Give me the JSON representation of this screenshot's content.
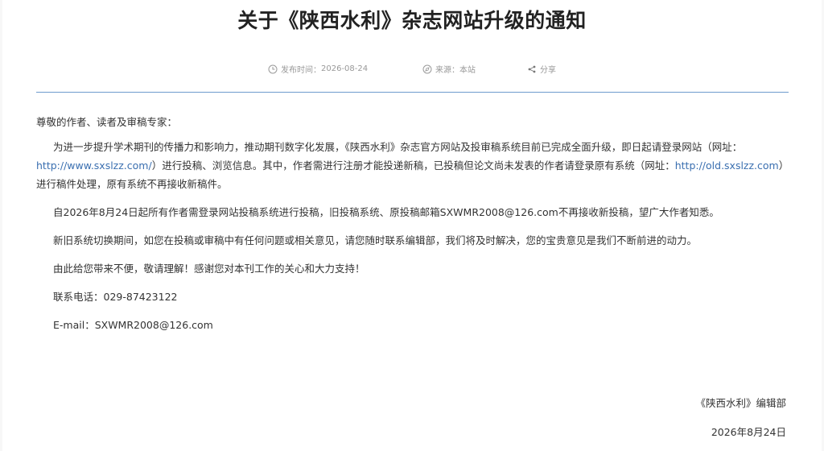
{
  "title": "关于《陕西水利》杂志网站升级的通知",
  "meta": {
    "publish_label": "发布时间：",
    "publish_date": "2026-08-24",
    "source_label": "来源：",
    "source_value": "本站",
    "share_label": "分享"
  },
  "body": {
    "salutation": "尊敬的作者、读者及审稿专家：",
    "p1_part1": "为进一步提升学术期刊的传播力和影响力，推动期刊数字化发展，《陕西水利》杂志官方网站及投审稿系统目前已完成全面升级，即日起请登录网站（网址：",
    "p1_link1": "http://www.sxslzz.com/",
    "p1_part2": "）进行投稿、浏览信息。其中，作者需进行注册才能投递新稿，已投稿但论文尚未发表的作者请登录原有系统（网址：",
    "p1_link2": "http://old.sxslzz.com",
    "p1_part3": "）进行稿件处理，原有系统不再接收新稿件。",
    "p2": "自2026年8月24日起所有作者需登录网站投稿系统进行投稿，旧投稿系统、原投稿邮箱SXWMR2008@126.com不再接收新投稿，望广大作者知悉。",
    "p3": "新旧系统切换期间，如您在投稿或审稿中有任何问题或相关意见，请您随时联系编辑部，我们将及时解决，您的宝贵意见是我们不断前进的动力。",
    "p4": "由此给您带来不便，敬请理解！感谢您对本刊工作的关心和大力支持！",
    "phone": "联系电话：029-87423122",
    "email": "E-mail：SXWMR2008@126.com"
  },
  "signature": "《陕西水利》编辑部",
  "sign_date": "2026年8月24日",
  "colors": {
    "divider": "#6f9ccd",
    "link": "#3a6fb0"
  },
  "icons": {
    "publish": "clock-icon",
    "source": "compass-icon",
    "share": "share-icon"
  }
}
